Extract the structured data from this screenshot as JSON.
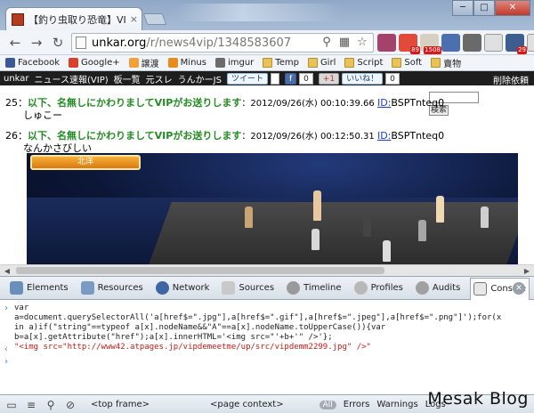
{
  "tab": {
    "title": "【釣り虫取り恐竜】VIPで",
    "close": "×"
  },
  "window": {
    "minimize": "─",
    "maximize": "□",
    "close": "✕"
  },
  "toolbar": {
    "back": "←",
    "forward": "→",
    "reload": "↻"
  },
  "url": {
    "host": "unkar.org",
    "path": "/r/news4vip/1348583607"
  },
  "extensions": [
    {
      "name": "ext-1",
      "badge": ""
    },
    {
      "name": "ext-2",
      "badge": "89"
    },
    {
      "name": "ext-3",
      "badge": "1508"
    },
    {
      "name": "ext-4",
      "badge": ""
    },
    {
      "name": "ext-5",
      "badge": ""
    },
    {
      "name": "ext-6",
      "badge": ""
    },
    {
      "name": "ext-7",
      "badge": "29"
    },
    {
      "name": "ext-8",
      "badge": ""
    }
  ],
  "bookmarks": [
    {
      "label": "Facebook",
      "icon": "fb"
    },
    {
      "label": "Google+",
      "icon": "gp"
    },
    {
      "label": "譲渡",
      "icon": "nav"
    },
    {
      "label": "Minus",
      "icon": "mi"
    },
    {
      "label": "imgur",
      "icon": "imgur"
    },
    {
      "label": "Temp",
      "icon": "folder"
    },
    {
      "label": "Girl",
      "icon": "folder"
    },
    {
      "label": "Script",
      "icon": "folder"
    },
    {
      "label": "Soft",
      "icon": "folder"
    },
    {
      "label": "賣物",
      "icon": "folder"
    }
  ],
  "site_nav": {
    "links": [
      "unkar",
      "ニュース速報(VIP)",
      "板一覧",
      "元スレ",
      "うんかーJS"
    ],
    "tweet": "ツイート",
    "tweet_count": "",
    "fb_like_count": "0",
    "gplus": "+1",
    "iine": "いいね！",
    "iine_count": "0",
    "delete_request": "削除依頼"
  },
  "search": {
    "button": "検索"
  },
  "posts": [
    {
      "num": "25：",
      "name": "以下、名無しにかわりましてVIPがお送りします",
      "date": "：2012/09/26(水) 00:10:39.66 ",
      "id_label": "ID:",
      "id": "BSPTnteq0",
      "body": "しゅこー"
    },
    {
      "num": "26：",
      "name": "以下、名無しにかわりましてVIPがお送りします",
      "date": "：2012/09/26(水) 00:12:50.31 ",
      "id_label": "ID:",
      "id": "BSPTnteq0",
      "body": "なんかさびしい"
    }
  ],
  "game_hud": "北洋",
  "devtools": {
    "tabs": [
      "Elements",
      "Resources",
      "Network",
      "Sources",
      "Timeline",
      "Profiles",
      "Audits",
      "Console"
    ],
    "active_tab": "Console",
    "console_lines": [
      "var",
      "a=document.querySelectorAll('a[href$=\".jpg\"],a[href$=\".gif\"],a[href$=\".jpeg\"],a[href$=\".png\"]');for(x",
      "in a)if(\"string\"==typeof a[x].nodeName&&\"A\"==a[x].nodeName.toUpperCase()){var",
      "b=a[x].getAttribute(\"href\");a[x].innerHTML='<img src=\"'+b+'\" />'};"
    ],
    "console_result": "\"<img src=\"http://www42.atpages.jp/vipdemeetme/up/src/vipdemm2299.jpg\" />\"",
    "status": {
      "top_frame": "<top frame>",
      "page_context": "<page context>",
      "all": "All",
      "filters": [
        "Errors",
        "Warnings",
        "Logs"
      ]
    }
  },
  "watermark": "Mesak Blog"
}
